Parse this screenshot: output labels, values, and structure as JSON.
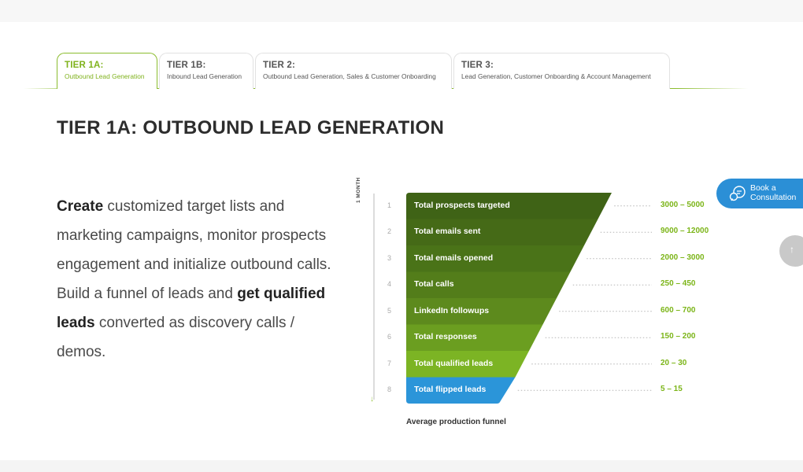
{
  "tabs": [
    {
      "title": "TIER 1A:",
      "subtitle": "Outbound Lead Generation",
      "active": true
    },
    {
      "title": "TIER 1B:",
      "subtitle": "Inbound Lead Generation",
      "active": false
    },
    {
      "title": "TIER 2:",
      "subtitle": "Outbound Lead Generation, Sales & Customer Onboarding",
      "active": false
    },
    {
      "title": "TIER 3:",
      "subtitle": "Lead Generation, Customer Onboarding & Account Management",
      "active": false
    }
  ],
  "section": {
    "heading": "TIER 1A: OUTBOUND LEAD GENERATION",
    "desc": {
      "bold1": "Create",
      "text1": " customized target lists and marketing campaigns, monitor prospects engagement and initialize outbound calls. Build a funnel of leads and ",
      "bold2": "get qualified leads",
      "text2": " converted as discovery calls / demos."
    }
  },
  "funnel": {
    "axis_label": "1 MONTH",
    "caption": "Average production funnel",
    "colors": [
      "#3f6316",
      "#456a17",
      "#4a7318",
      "#537d1a",
      "#5d8a1d",
      "#6b9e20",
      "#7cb424",
      "#2b95d9"
    ],
    "rows": [
      {
        "num": "1",
        "label": "Total prospects targeted",
        "value": "3000 – 5000"
      },
      {
        "num": "2",
        "label": "Total emails sent",
        "value": "9000 – 12000"
      },
      {
        "num": "3",
        "label": "Total emails opened",
        "value": "2000 – 3000"
      },
      {
        "num": "4",
        "label": "Total calls",
        "value": "250 – 450"
      },
      {
        "num": "5",
        "label": "LinkedIn followups",
        "value": "600 – 700"
      },
      {
        "num": "6",
        "label": "Total responses",
        "value": "150 – 200"
      },
      {
        "num": "7",
        "label": "Total qualified leads",
        "value": "20 – 30"
      },
      {
        "num": "8",
        "label": "Total flipped leads",
        "value": "5 – 15"
      }
    ]
  },
  "widgets": {
    "consult_line1": "Book a",
    "consult_line2": "Consultation",
    "scroll_top_glyph": "↑"
  }
}
